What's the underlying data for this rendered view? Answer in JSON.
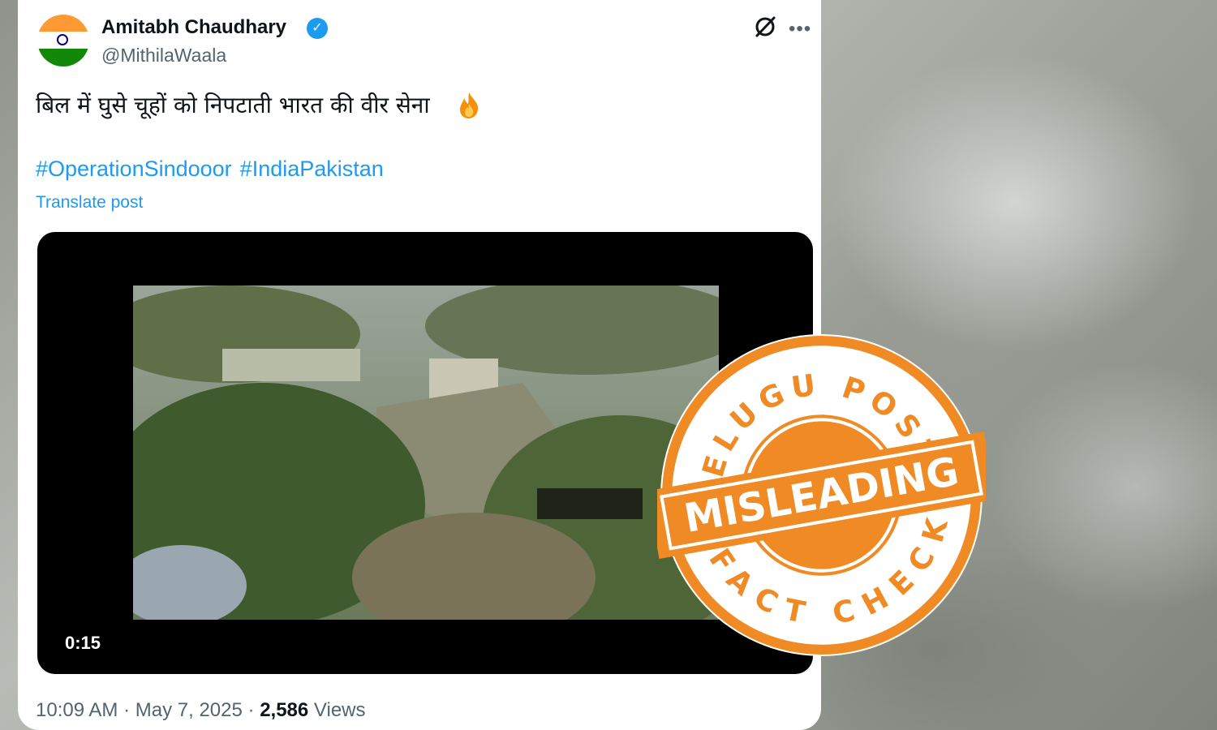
{
  "tweet": {
    "author_name": "Amitabh Chaudhary",
    "handle": "@MithilaWaala",
    "text": "बिल में घुसे चूहों को निपटाती भारत की वीर सेना",
    "hashtags": [
      "#OperationSindooor",
      "#IndiaPakistan"
    ],
    "translate_label": "Translate post",
    "video_duration": "0:15",
    "time": "10:09 AM",
    "date": "May 7, 2025",
    "views_count": "2,586",
    "views_label": "Views",
    "separator": "·"
  },
  "icons": {
    "verified": "verified-badge-icon",
    "grok": "grok-icon",
    "more": "more-icon",
    "emoji": "fire-emoji"
  },
  "stamp": {
    "top_text": "TELUGU POST",
    "verdict": "MISLEADING",
    "bottom_text": "FACT CHECK",
    "color": "#f08a24"
  },
  "colors": {
    "link": "#1d9bf0",
    "text": "#0f1419",
    "secondary": "#536471"
  }
}
